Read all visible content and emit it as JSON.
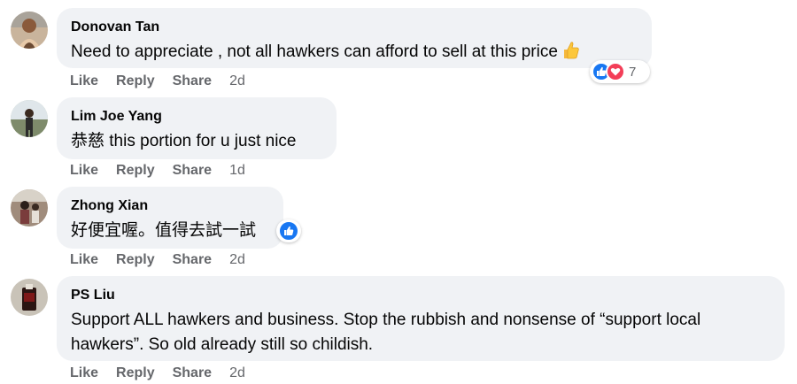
{
  "actions": {
    "like": "Like",
    "reply": "Reply",
    "share": "Share"
  },
  "comments": [
    {
      "author": "Donovan Tan",
      "text": "Need to appreciate , not all hawkers can afford to sell at this price",
      "time": "2d",
      "reaction_count": "7",
      "reactions": [
        "like-icon",
        "love-icon"
      ],
      "inline_emoji": "thumbs-up-emoji"
    },
    {
      "author": "Lim Joe Yang",
      "text": "恭慈 this portion for u just nice",
      "time": "1d"
    },
    {
      "author": "Zhong Xian",
      "text": "好便宜喔。值得去試一試",
      "time": "2d",
      "reactions": [
        "like-icon"
      ]
    },
    {
      "author": "PS Liu",
      "text": "Support ALL hawkers and business. Stop the rubbish and nonsense of “support local hawkers”. So old already still so childish.",
      "time": "2d"
    }
  ],
  "colors": {
    "bubble": "#f0f2f5",
    "meta": "#65676b",
    "like": "#1877f2",
    "love": "#f33e58"
  }
}
